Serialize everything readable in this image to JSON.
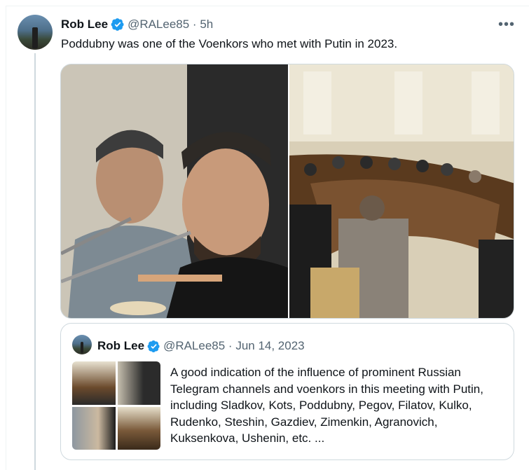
{
  "tweet": {
    "author_name": "Rob Lee",
    "handle_time": "@RALee85 · 5h",
    "text": "Poddubny was one of the Voenkors who met with Putin in 2023.",
    "more_icon": "more-horizontal-icon",
    "verified_icon": "verified-badge-icon",
    "verified_color": "#1d9bf0"
  },
  "media": {
    "images": [
      {
        "alt": "Two men seated at a table with microphones"
      },
      {
        "alt": "Meeting around a long oval wooden table"
      }
    ]
  },
  "quote": {
    "author_name": "Rob Lee",
    "handle_time": "@RALee85 · Jun 14, 2023",
    "text": "A good indication of the influence of prominent Russian Telegram channels and voenkors in this meeting with Putin, including Sladkov, Kots, Poddubny, Pegov, Filatov, Kulko, Rudenko, Steshin, Gazdiev, Zimenkin, Agranovich, Kuksenkova, Ushenin, etc. ..."
  },
  "colors": {
    "text_primary": "#0f1419",
    "text_secondary": "#536471",
    "border": "#cfd9de"
  }
}
